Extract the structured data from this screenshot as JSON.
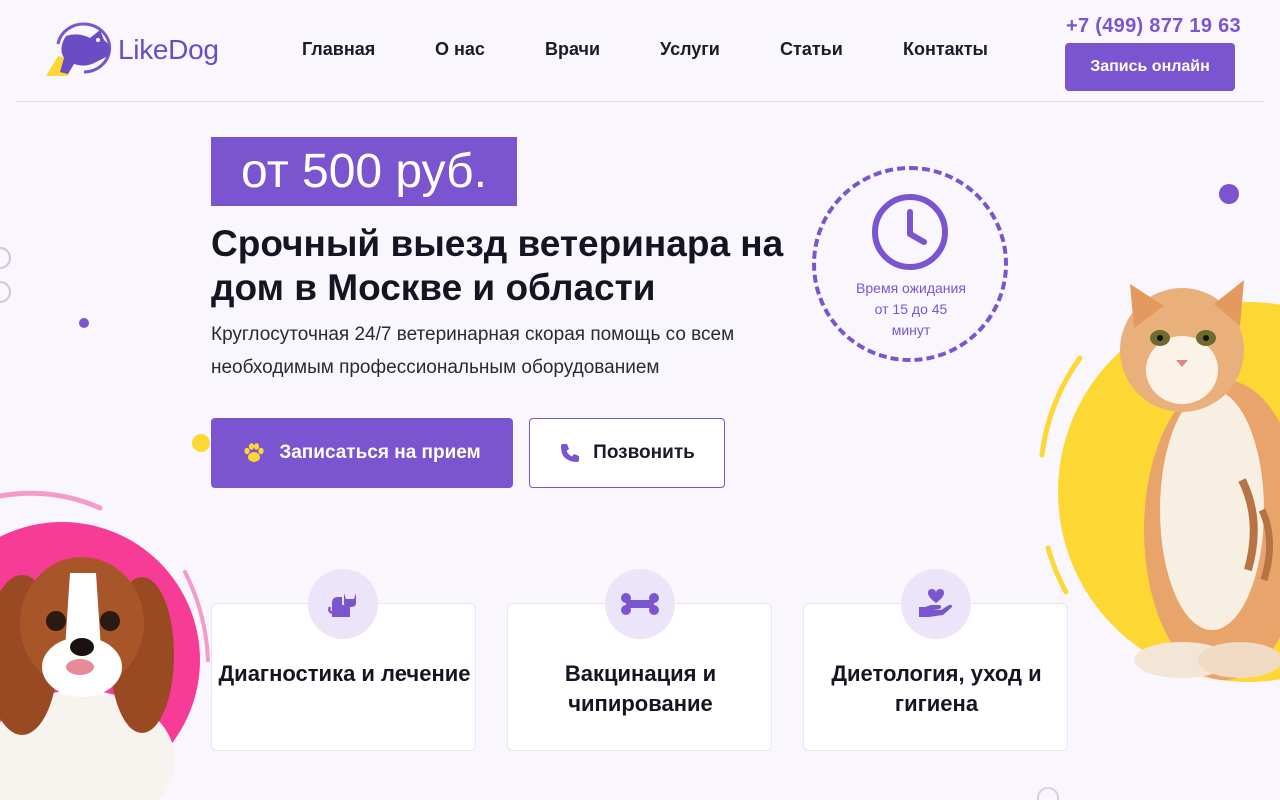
{
  "header": {
    "logo_text": "LikeDog",
    "nav": [
      "Главная",
      "О нас",
      "Врачи",
      "Услуги",
      "Статьи",
      "Контакты"
    ],
    "phone": "+7 (499) 877 19 63",
    "cta_label": "Запись онлайн"
  },
  "hero": {
    "price": "от 500 руб.",
    "title": "Срочный выезд ветеринара на дом в Москве и области",
    "subtitle": "Круглосуточная 24/7 ветеринарная скорая помощь со всем необходимым профессиональным оборудованием",
    "primary_button": "Записаться на прием",
    "secondary_button": "Позвонить",
    "wait_badge": "Время ожидания от 15 до 45 минут"
  },
  "services": [
    {
      "title": "Диагностика и лечение",
      "icon": "cat-icon"
    },
    {
      "title": "Вакцинация и чипирование",
      "icon": "bone-icon"
    },
    {
      "title": "Диетология, уход и гигиена",
      "icon": "heart-hand-icon"
    }
  ],
  "colors": {
    "accent": "#7b55cf",
    "background": "#f9f6fd",
    "yellow": "#fdd835",
    "pink": "#f73c97"
  }
}
